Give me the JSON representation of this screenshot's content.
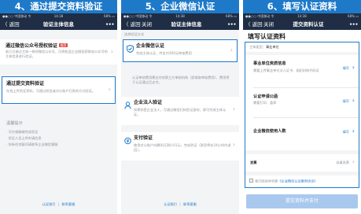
{
  "panel1": {
    "step_title": "4、通过提交资料验证",
    "status": {
      "carrier": "●●○○ 中国移动 令",
      "time": "14:38",
      "battery": "68% ▭"
    },
    "nav": {
      "back": "〈 返回",
      "title": "验证主体信息",
      "more": "•••"
    },
    "option1": {
      "title": "通过微信公众号授权验证",
      "badge": "推荐",
      "desc": "若已注册过主体一致的微信公众号，可授权此企业微信获取该公众号的主体信息进行验证。"
    },
    "option2": {
      "title": "通过提交资料验证",
      "desc": "在线上传验证资料，可通过短信或对公账户打款的方式验证。"
    },
    "tips": {
      "header": "温馨提示",
      "items": [
        "· 可在电脑端完成验证",
        "· 验证人员上传申请信息",
        "· 如有任何疑问请联系企业微信客服"
      ]
    },
    "footer": {
      "guide": "认证指引",
      "service": "联系客服"
    }
  },
  "panel2": {
    "step_title": "5、企业微信认证",
    "status": {
      "carrier": "●●○○ 中国移动 令",
      "time": "14:38",
      "battery": "68% ▭"
    },
    "nav": {
      "back": "〈 返回",
      "close": "关闭",
      "title": "验证主体信息",
      "more": "•••"
    },
    "section_label": "选择验证方式",
    "option1": {
      "title": "企业微信认证",
      "desc": "完成主体认证，并支付300元审核费用"
    },
    "note": "认证审核费用需支付给第三方审核机构（即收取审核费用），费用将于认证通过后支付。",
    "option2": {
      "title": "企业法人验证",
      "desc": "如果你是企业法人，可通过微信扫码验证身份，即可完成主体认证。"
    },
    "option3": {
      "title": "支付验证",
      "desc": "使用对公账户向腾讯打款0.01元，完成验证（款项将在24小时内退回）。"
    },
    "footer": {
      "guide": "认证指引",
      "service": "联系客服"
    }
  },
  "panel3": {
    "step_title": "6、填写认证资料",
    "status": {
      "carrier": "●●○○ 中国移动 令",
      "time": "14:38",
      "battery": "68% ▭"
    },
    "nav": {
      "back": "〈 返回",
      "close": "关闭",
      "title": "提交资料认证",
      "more": "•••"
    },
    "page_heading": "填写认证资料",
    "subject_type": {
      "label": "主体类型：",
      "value": "事业单位"
    },
    "rows": [
      {
        "title": "事业单位资质信息",
        "desc": "需要上传事业单位法人证书、组织机构代码证",
        "action": "填写"
      },
      {
        "title": "认证申请公函",
        "desc": "需要打印、盖章",
        "action": "填写"
      },
      {
        "title": "企业微信使用人数",
        "desc": "",
        "action": "填写"
      }
    ],
    "invoice": {
      "label": "发票",
      "value": "选填发票"
    },
    "agreement": {
      "prefix": "我已阅读并同意",
      "link": "《企业微信认证服务协议》"
    },
    "submit_label": "提交资料并支付"
  },
  "colors": {
    "step_banner": "#1e7ac9",
    "nav_bar": "#1f2e45",
    "highlight_border": "#1e7ac9",
    "link_blue": "#1e78c8",
    "badge_red": "#e64340",
    "icon_green": "#1aad19",
    "submit_button": "#a9c8ee"
  }
}
